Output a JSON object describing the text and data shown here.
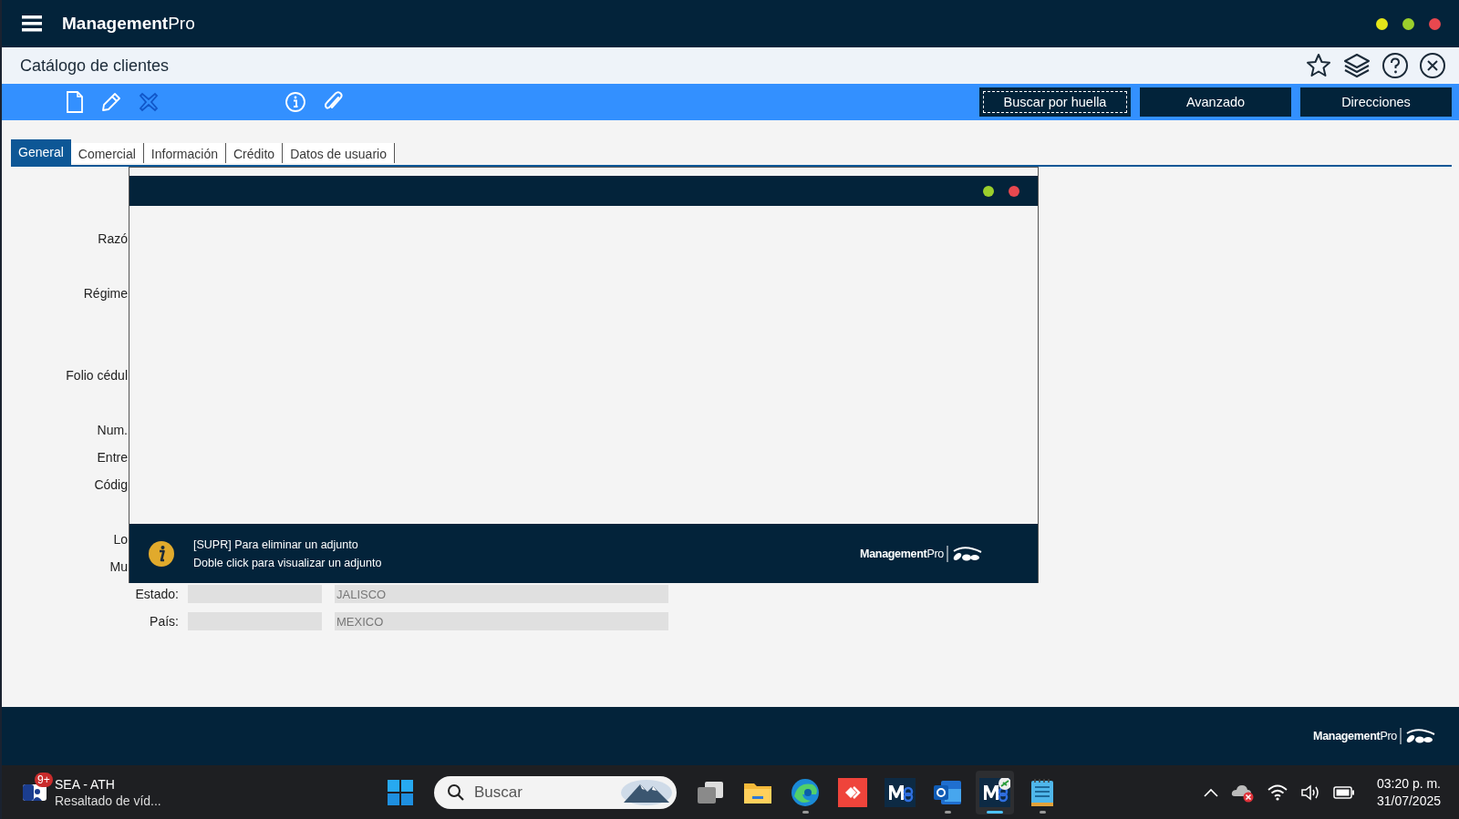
{
  "app": {
    "brand_bold": "Management",
    "brand_light": "Pro"
  },
  "page_title": "Catálogo de clientes",
  "toolbar": {
    "buttons": [
      {
        "label": "Buscar por huella",
        "focused": true
      },
      {
        "label": "Avanzado",
        "focused": false
      },
      {
        "label": "Direcciones",
        "focused": false
      }
    ]
  },
  "tabs": [
    {
      "label": "General",
      "selected": true
    },
    {
      "label": "Comercial",
      "selected": false
    },
    {
      "label": "Información",
      "selected": false
    },
    {
      "label": "Crédito",
      "selected": false
    },
    {
      "label": "Datos de usuario",
      "selected": false
    }
  ],
  "form": {
    "fields": [
      {
        "kind": "label",
        "label": "Razó"
      },
      {
        "kind": "label",
        "label": "Régime"
      },
      {
        "kind": "label",
        "label": "Folio cédul"
      },
      {
        "kind": "label",
        "label": "Num."
      },
      {
        "kind": "label",
        "label": "Entre"
      },
      {
        "kind": "label",
        "label": "Códig"
      },
      {
        "kind": "label",
        "label": "Lo"
      },
      {
        "kind": "label",
        "label": "Mu"
      },
      {
        "kind": "location",
        "label": "Estado:",
        "value": "JALISCO"
      },
      {
        "kind": "location",
        "label": "País:",
        "value": "MEXICO"
      }
    ]
  },
  "dialog": {
    "messages": [
      "[SUPR] Para eliminar un adjunto",
      "Doble click para visualizar un adjunto"
    ],
    "logo": {
      "bold": "Management",
      "light": "Pro"
    }
  },
  "footer": {
    "logo": {
      "bold": "Management",
      "light": "Pro"
    }
  },
  "taskbar": {
    "notification": {
      "badge": "9+",
      "title": "SEA - ATH",
      "subtitle": "Resaltado de víd..."
    },
    "search": {
      "placeholder": "Buscar"
    },
    "apps": [
      {
        "kind": "taskview",
        "running": false,
        "selected": false
      },
      {
        "kind": "folder",
        "running": false,
        "selected": false
      },
      {
        "kind": "browser",
        "running": true,
        "selected": false
      },
      {
        "kind": "remote",
        "running": false,
        "selected": false
      },
      {
        "kind": "m",
        "running": false,
        "selected": false
      },
      {
        "kind": "mail",
        "running": true,
        "selected": false
      },
      {
        "kind": "m-remote",
        "running": true,
        "selected": true
      },
      {
        "kind": "notepad",
        "running": true,
        "selected": false
      }
    ],
    "clock": {
      "time": "03:20 p. m.",
      "date": "31/07/2025"
    }
  }
}
